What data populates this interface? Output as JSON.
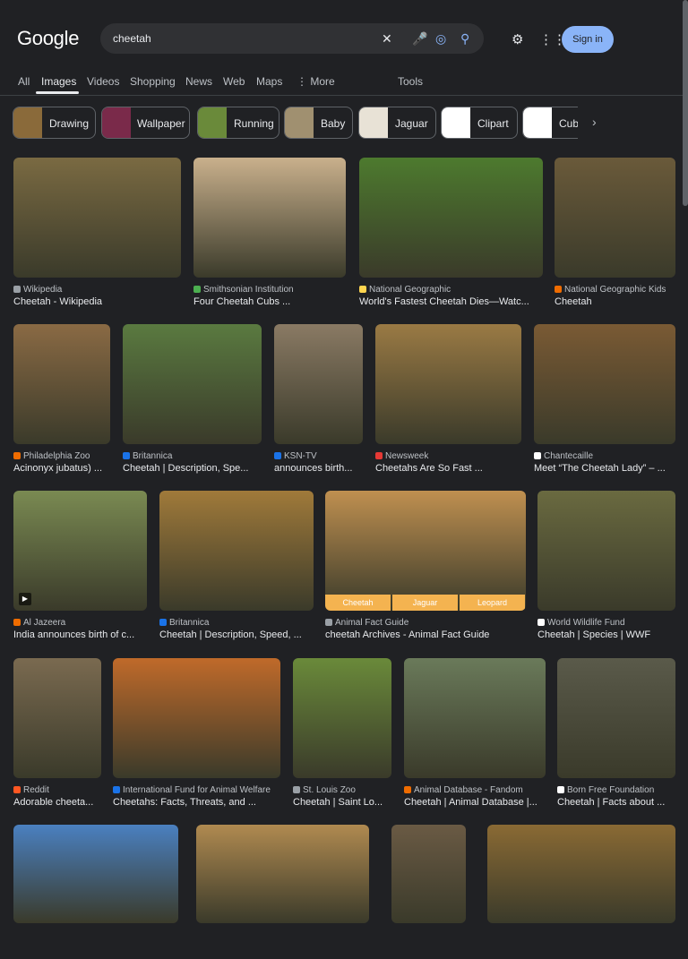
{
  "logo": "Google",
  "search": {
    "query": "cheetah",
    "clear_icon": "close-icon",
    "mic_icon": "mic-icon",
    "lens_icon": "lens-icon",
    "search_icon": "search-icon"
  },
  "header": {
    "settings_icon": "gear-icon",
    "apps_icon": "apps-icon",
    "signin_label": "Sign in"
  },
  "tabs": [
    {
      "label": "All"
    },
    {
      "label": "Images"
    },
    {
      "label": "Videos"
    },
    {
      "label": "Shopping"
    },
    {
      "label": "News"
    },
    {
      "label": "Web"
    },
    {
      "label": "Maps"
    },
    {
      "label": "⋮ More"
    },
    {
      "label": "Tools"
    }
  ],
  "chips": [
    {
      "label": "Drawing"
    },
    {
      "label": "Wallpaper"
    },
    {
      "label": "Running"
    },
    {
      "label": "Baby"
    },
    {
      "label": "Jaguar"
    },
    {
      "label": "Clipart"
    },
    {
      "label": "Cub"
    }
  ],
  "results": [
    {
      "source": "Wikipedia",
      "title": "Cheetah - Wikipedia"
    },
    {
      "source": "Smithsonian Institution",
      "title": "Four Cheetah Cubs ..."
    },
    {
      "source": "National Geographic",
      "title": "World's Fastest Cheetah Dies—Watc..."
    },
    {
      "source": "National Geographic Kids",
      "title": "Cheetah"
    },
    {
      "source": "Philadelphia Zoo",
      "title": "Acinonyx jubatus) ..."
    },
    {
      "source": "Britannica",
      "title": "Cheetah | Description, Spe..."
    },
    {
      "source": "KSN-TV",
      "title": "announces birth..."
    },
    {
      "source": "Newsweek",
      "title": "Cheetahs Are So Fast ..."
    },
    {
      "source": "Chantecaille",
      "title": "Meet “The Cheetah Lady” – ..."
    },
    {
      "source": "Al Jazeera",
      "title": "India announces birth of c..."
    },
    {
      "source": "Britannica",
      "title": "Cheetah | Description, Speed, ..."
    },
    {
      "source": "Animal Fact Guide",
      "title": "cheetah Archives - Animal Fact Guide"
    },
    {
      "source": "World Wildlife Fund",
      "title": "Cheetah | Species | WWF"
    },
    {
      "source": "Reddit",
      "title": "Adorable cheeta..."
    },
    {
      "source": "International Fund for Animal Welfare",
      "title": "Cheetahs: Facts, Threats, and ..."
    },
    {
      "source": "St. Louis Zoo",
      "title": "Cheetah | Saint Lo..."
    },
    {
      "source": "Animal Database - Fandom",
      "title": "Cheetah | Animal Database |..."
    },
    {
      "source": "Born Free Foundation",
      "title": "Cheetah | Facts about ..."
    }
  ],
  "composite_labels": [
    "Cheetah",
    "Jaguar",
    "Leopard"
  ]
}
